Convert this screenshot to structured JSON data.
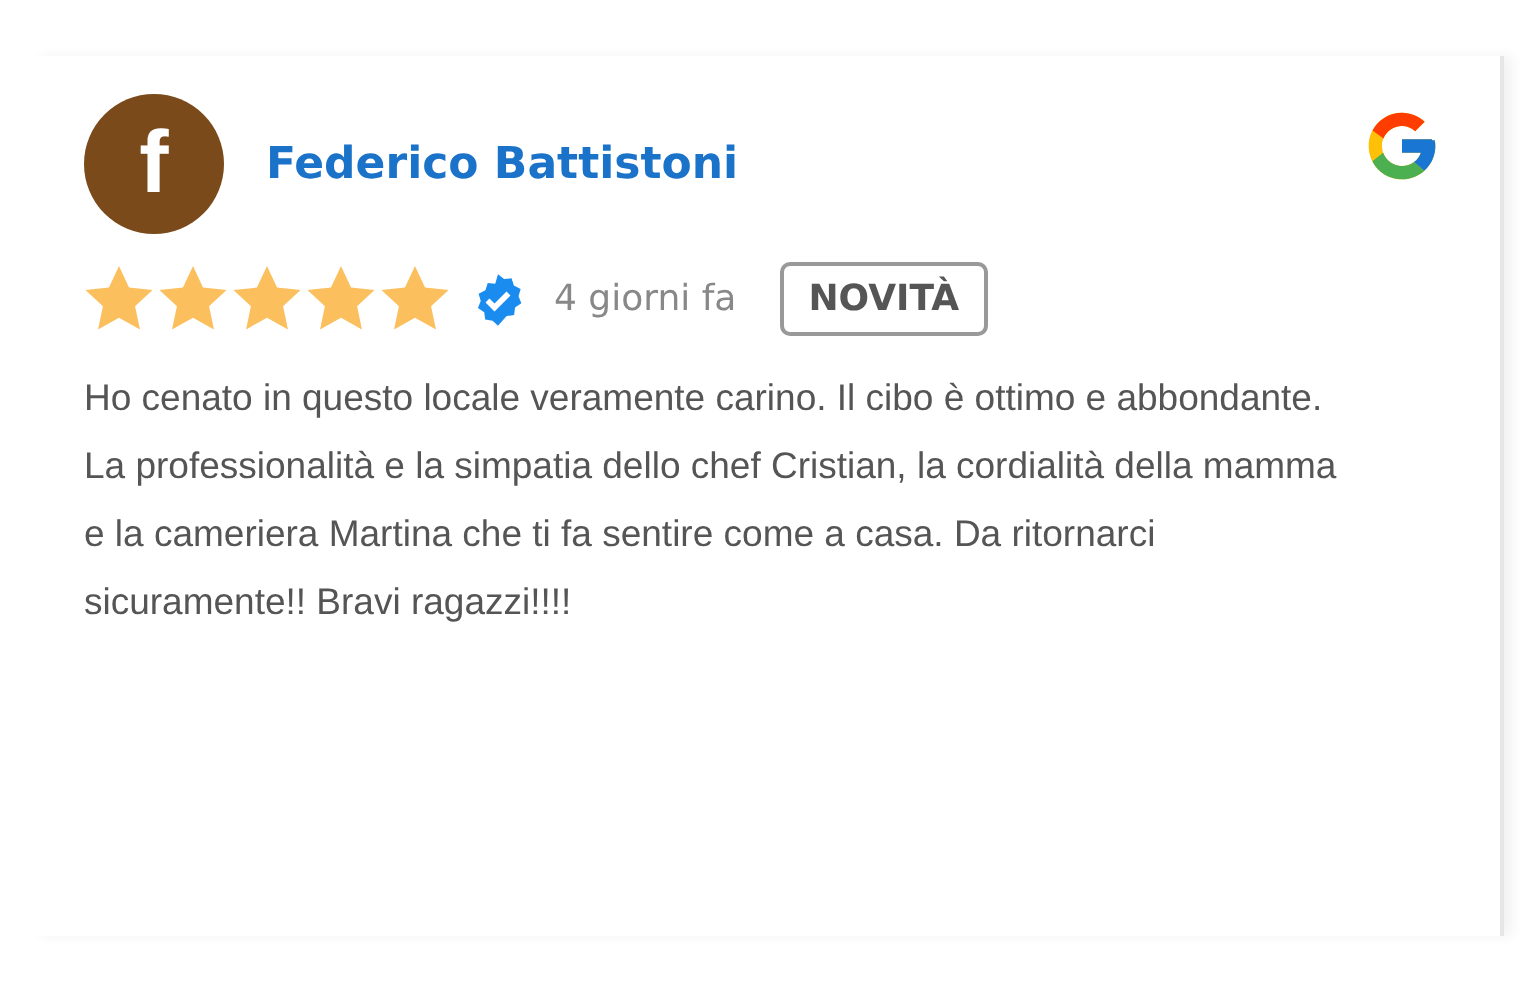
{
  "review": {
    "avatar_letter": "f",
    "author": "Federico Battistoni",
    "stars": 5,
    "verified": true,
    "time": "4 giorni fa",
    "badge": "NOVITÀ",
    "text": "Ho cenato in questo locale veramente carino. Il cibo è ottimo e abbondante. La professionalità e la simpatia dello chef Cristian, la cordialità della mamma e la cameriera Martina che ti fa sentire come a casa. Da ritornarci sicuramente!! Bravi ragazzi!!!!"
  }
}
